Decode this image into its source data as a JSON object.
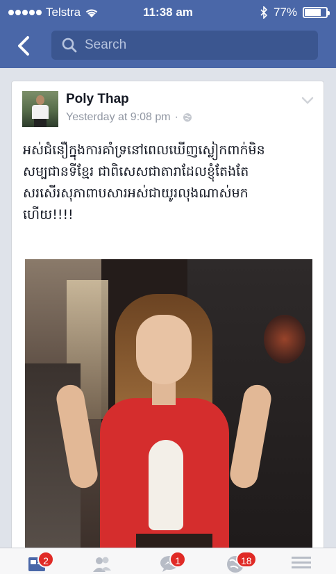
{
  "status_bar": {
    "carrier": "Telstra",
    "time": "11:38 am",
    "battery_percent": "77%",
    "battery_level": 0.77
  },
  "nav": {
    "search_placeholder": "Search"
  },
  "post": {
    "author": "Poly Thap",
    "timestamp": "Yesterday at 9:08 pm",
    "separator": "·",
    "text_lines": [
      "អស់ជំនឿក្នុងការគាំទ្រនៅពេលឃើញស្លៀកពាក់មិន",
      "សម្បជានទីខ្មែរ ជាពិសេសជាតារាដែលខ្ញុំតែងតែ",
      "សរសើរសុភាពាបសារអស់ជាយូរលុងណាស់មក",
      "ហើយ!!!!"
    ]
  },
  "tab_bar": {
    "feed_badge": "2",
    "messenger_badge": "1",
    "notifications_badge": "18"
  },
  "colors": {
    "brand": "#4a67a8",
    "badge": "#e02a26"
  }
}
